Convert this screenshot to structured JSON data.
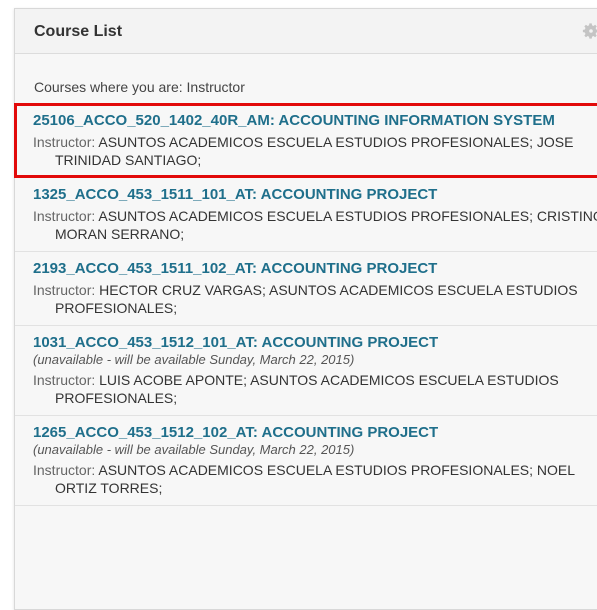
{
  "module": {
    "title": "Course List",
    "settings_icon": "gear-icon",
    "intro": "Courses where you are: Instructor"
  },
  "courses": [
    {
      "link": "25106_ACCO_520_1402_40R_AM: ACCOUNTING INFORMATION SYSTEM",
      "note": "",
      "instructor_label": "Instructor:",
      "instructors": "ASUNTOS ACADEMICOS ESCUELA ESTUDIOS PROFESIONALES;  JOSE TRINIDAD SANTIAGO;"
    },
    {
      "link": "1325_ACCO_453_1511_101_AT: ACCOUNTING PROJECT",
      "note": "",
      "instructor_label": "Instructor:",
      "instructors": "ASUNTOS ACADEMICOS ESCUELA ESTUDIOS PROFESIONALES;  CRISTINO MORAN SERRANO;"
    },
    {
      "link": "2193_ACCO_453_1511_102_AT: ACCOUNTING PROJECT",
      "note": "",
      "instructor_label": "Instructor:",
      "instructors": "HECTOR CRUZ VARGAS;  ASUNTOS ACADEMICOS ESCUELA ESTUDIOS PROFESIONALES;"
    },
    {
      "link": "1031_ACCO_453_1512_101_AT: ACCOUNTING PROJECT",
      "note": "(unavailable - will be available Sunday, March 22, 2015)",
      "instructor_label": "Instructor:",
      "instructors": "LUIS ACOBE APONTE;  ASUNTOS ACADEMICOS ESCUELA ESTUDIOS PROFESIONALES;"
    },
    {
      "link": "1265_ACCO_453_1512_102_AT: ACCOUNTING PROJECT",
      "note": "(unavailable - will be available Sunday, March 22, 2015)",
      "instructor_label": "Instructor:",
      "instructors": "ASUNTOS ACADEMICOS ESCUELA ESTUDIOS PROFESIONALES;  NOEL ORTIZ TORRES;"
    }
  ],
  "colors": {
    "link": "#1f6f8b",
    "highlight_border": "#e20a0a"
  }
}
